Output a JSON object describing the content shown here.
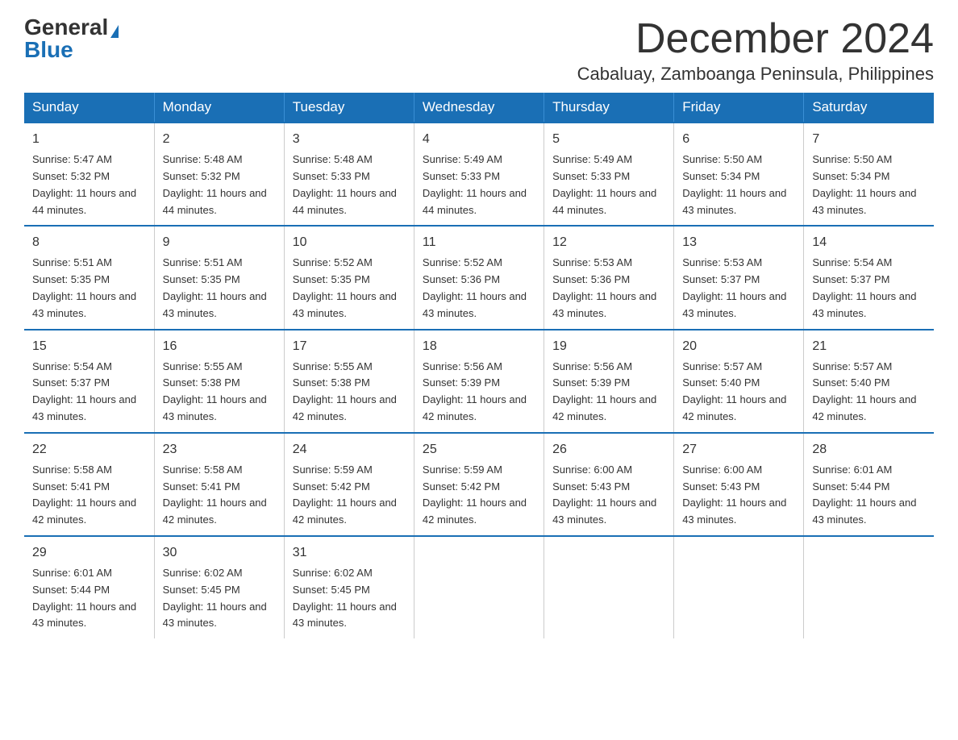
{
  "logo": {
    "general": "General",
    "blue": "Blue"
  },
  "title": "December 2024",
  "subtitle": "Cabaluay, Zamboanga Peninsula, Philippines",
  "days_of_week": [
    "Sunday",
    "Monday",
    "Tuesday",
    "Wednesday",
    "Thursday",
    "Friday",
    "Saturday"
  ],
  "weeks": [
    [
      {
        "day": "1",
        "sunrise": "5:47 AM",
        "sunset": "5:32 PM",
        "daylight": "11 hours and 44 minutes."
      },
      {
        "day": "2",
        "sunrise": "5:48 AM",
        "sunset": "5:32 PM",
        "daylight": "11 hours and 44 minutes."
      },
      {
        "day": "3",
        "sunrise": "5:48 AM",
        "sunset": "5:33 PM",
        "daylight": "11 hours and 44 minutes."
      },
      {
        "day": "4",
        "sunrise": "5:49 AM",
        "sunset": "5:33 PM",
        "daylight": "11 hours and 44 minutes."
      },
      {
        "day": "5",
        "sunrise": "5:49 AM",
        "sunset": "5:33 PM",
        "daylight": "11 hours and 44 minutes."
      },
      {
        "day": "6",
        "sunrise": "5:50 AM",
        "sunset": "5:34 PM",
        "daylight": "11 hours and 43 minutes."
      },
      {
        "day": "7",
        "sunrise": "5:50 AM",
        "sunset": "5:34 PM",
        "daylight": "11 hours and 43 minutes."
      }
    ],
    [
      {
        "day": "8",
        "sunrise": "5:51 AM",
        "sunset": "5:35 PM",
        "daylight": "11 hours and 43 minutes."
      },
      {
        "day": "9",
        "sunrise": "5:51 AM",
        "sunset": "5:35 PM",
        "daylight": "11 hours and 43 minutes."
      },
      {
        "day": "10",
        "sunrise": "5:52 AM",
        "sunset": "5:35 PM",
        "daylight": "11 hours and 43 minutes."
      },
      {
        "day": "11",
        "sunrise": "5:52 AM",
        "sunset": "5:36 PM",
        "daylight": "11 hours and 43 minutes."
      },
      {
        "day": "12",
        "sunrise": "5:53 AM",
        "sunset": "5:36 PM",
        "daylight": "11 hours and 43 minutes."
      },
      {
        "day": "13",
        "sunrise": "5:53 AM",
        "sunset": "5:37 PM",
        "daylight": "11 hours and 43 minutes."
      },
      {
        "day": "14",
        "sunrise": "5:54 AM",
        "sunset": "5:37 PM",
        "daylight": "11 hours and 43 minutes."
      }
    ],
    [
      {
        "day": "15",
        "sunrise": "5:54 AM",
        "sunset": "5:37 PM",
        "daylight": "11 hours and 43 minutes."
      },
      {
        "day": "16",
        "sunrise": "5:55 AM",
        "sunset": "5:38 PM",
        "daylight": "11 hours and 43 minutes."
      },
      {
        "day": "17",
        "sunrise": "5:55 AM",
        "sunset": "5:38 PM",
        "daylight": "11 hours and 42 minutes."
      },
      {
        "day": "18",
        "sunrise": "5:56 AM",
        "sunset": "5:39 PM",
        "daylight": "11 hours and 42 minutes."
      },
      {
        "day": "19",
        "sunrise": "5:56 AM",
        "sunset": "5:39 PM",
        "daylight": "11 hours and 42 minutes."
      },
      {
        "day": "20",
        "sunrise": "5:57 AM",
        "sunset": "5:40 PM",
        "daylight": "11 hours and 42 minutes."
      },
      {
        "day": "21",
        "sunrise": "5:57 AM",
        "sunset": "5:40 PM",
        "daylight": "11 hours and 42 minutes."
      }
    ],
    [
      {
        "day": "22",
        "sunrise": "5:58 AM",
        "sunset": "5:41 PM",
        "daylight": "11 hours and 42 minutes."
      },
      {
        "day": "23",
        "sunrise": "5:58 AM",
        "sunset": "5:41 PM",
        "daylight": "11 hours and 42 minutes."
      },
      {
        "day": "24",
        "sunrise": "5:59 AM",
        "sunset": "5:42 PM",
        "daylight": "11 hours and 42 minutes."
      },
      {
        "day": "25",
        "sunrise": "5:59 AM",
        "sunset": "5:42 PM",
        "daylight": "11 hours and 42 minutes."
      },
      {
        "day": "26",
        "sunrise": "6:00 AM",
        "sunset": "5:43 PM",
        "daylight": "11 hours and 43 minutes."
      },
      {
        "day": "27",
        "sunrise": "6:00 AM",
        "sunset": "5:43 PM",
        "daylight": "11 hours and 43 minutes."
      },
      {
        "day": "28",
        "sunrise": "6:01 AM",
        "sunset": "5:44 PM",
        "daylight": "11 hours and 43 minutes."
      }
    ],
    [
      {
        "day": "29",
        "sunrise": "6:01 AM",
        "sunset": "5:44 PM",
        "daylight": "11 hours and 43 minutes."
      },
      {
        "day": "30",
        "sunrise": "6:02 AM",
        "sunset": "5:45 PM",
        "daylight": "11 hours and 43 minutes."
      },
      {
        "day": "31",
        "sunrise": "6:02 AM",
        "sunset": "5:45 PM",
        "daylight": "11 hours and 43 minutes."
      },
      null,
      null,
      null,
      null
    ]
  ]
}
